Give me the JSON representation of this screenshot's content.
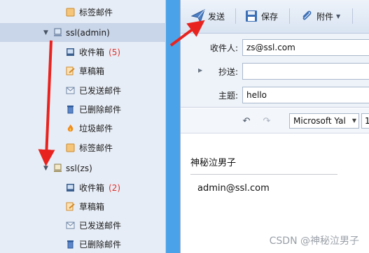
{
  "sidebar": {
    "top_folder": {
      "label": "标签邮件",
      "icon": "tag-icon"
    },
    "accounts": [
      {
        "name": "ssl(admin)",
        "selected": true,
        "folders": [
          {
            "label": "收件箱",
            "count": "(5)",
            "icon": "inbox-icon"
          },
          {
            "label": "草稿箱",
            "count": "",
            "icon": "drafts-icon"
          },
          {
            "label": "已发送邮件",
            "count": "",
            "icon": "sent-icon"
          },
          {
            "label": "已删除邮件",
            "count": "",
            "icon": "trash-icon"
          },
          {
            "label": "垃圾邮件",
            "count": "",
            "icon": "junk-icon"
          },
          {
            "label": "标签邮件",
            "count": "",
            "icon": "tag-icon"
          }
        ]
      },
      {
        "name": "ssl(zs)",
        "selected": false,
        "folders": [
          {
            "label": "收件箱",
            "count": "(2)",
            "icon": "inbox-icon"
          },
          {
            "label": "草稿箱",
            "count": "",
            "icon": "drafts-icon"
          },
          {
            "label": "已发送邮件",
            "count": "",
            "icon": "sent-icon"
          },
          {
            "label": "已删除邮件",
            "count": "",
            "icon": "trash-icon"
          }
        ]
      }
    ]
  },
  "toolbar": {
    "send_label": "发送",
    "save_label": "保存",
    "attach_label": "附件"
  },
  "compose": {
    "to_label": "收件人:",
    "to_value": "zs@ssl.com",
    "cc_label": "抄送:",
    "cc_value": "",
    "subject_label": "主题:",
    "subject_value": "hello",
    "font_value": "Microsoft Yal",
    "font_size_value": "1",
    "body": {
      "signature_name": "神秘泣男子",
      "signature_email": "admin@ssl.com"
    }
  },
  "watermark": "CSDN @神秘泣男子",
  "colors": {
    "sidebar_bg": "#e7edf6",
    "selected_row": "#c9d6e9",
    "count_red": "#e0302a",
    "gap_blue": "#4aa3e8",
    "arrow_red": "#e8231f"
  }
}
